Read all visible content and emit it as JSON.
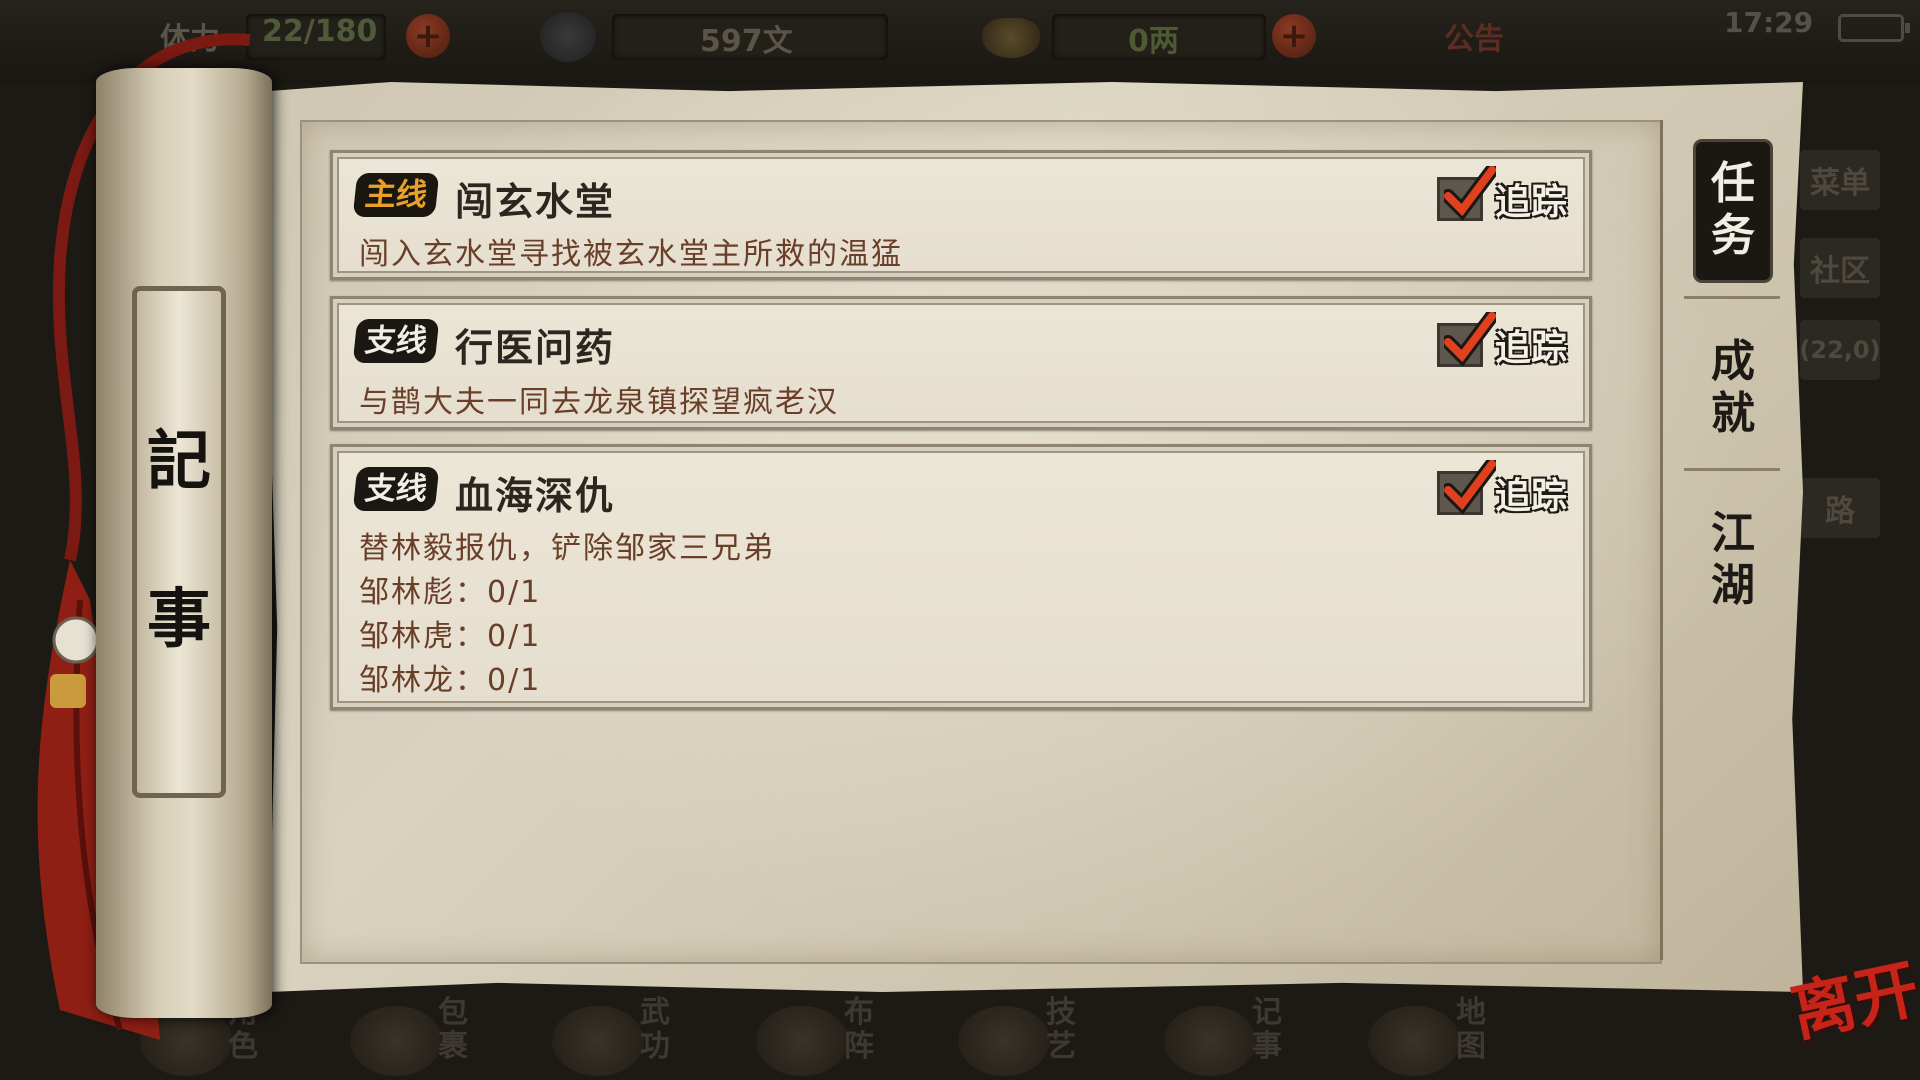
{
  "hud": {
    "stamina_label": "体力",
    "stamina_value": "22/180",
    "copper_value": "597文",
    "silver_value": "0两",
    "notice_label": "公告",
    "time": "17:29"
  },
  "side_menu": [
    "菜单",
    "社区",
    "(22,0)",
    "路"
  ],
  "bottom_nav": [
    {
      "label": "角色",
      "icon": "character-icon"
    },
    {
      "label": "包裹",
      "icon": "bag-icon"
    },
    {
      "label": "武功",
      "icon": "martial-arts-icon"
    },
    {
      "label": "布阵",
      "icon": "formation-icon"
    },
    {
      "label": "技艺",
      "icon": "skills-icon"
    },
    {
      "label": "记事",
      "icon": "journal-icon"
    },
    {
      "label": "地图",
      "icon": "map-icon"
    }
  ],
  "panel": {
    "title_line1": "記",
    "title_line2": "事"
  },
  "tabs": [
    {
      "line1": "任",
      "line2": "务",
      "active": true
    },
    {
      "line1": "成",
      "line2": "就",
      "active": false
    },
    {
      "line1": "江",
      "line2": "湖",
      "active": false
    }
  ],
  "quests": [
    {
      "type": "主线",
      "title": "闯玄水堂",
      "desc": "闯入玄水堂寻找被玄水堂主所救的温猛",
      "tracked": true,
      "track_label": "追踪",
      "objectives": []
    },
    {
      "type": "支线",
      "title": "行医问药",
      "desc": "与鹊大夫一同去龙泉镇探望疯老汉",
      "tracked": true,
      "track_label": "追踪",
      "objectives": []
    },
    {
      "type": "支线",
      "title": "血海深仇",
      "desc": "替林毅报仇，铲除邹家三兄弟",
      "tracked": true,
      "track_label": "追踪",
      "objectives": [
        "邹林彪：0/1",
        "邹林虎：0/1",
        "邹林龙：0/1"
      ]
    }
  ],
  "leave_label": "离开",
  "colors": {
    "accent_main": "#e9a12a",
    "check_red": "#e0401e",
    "leave_red": "#c62418"
  }
}
